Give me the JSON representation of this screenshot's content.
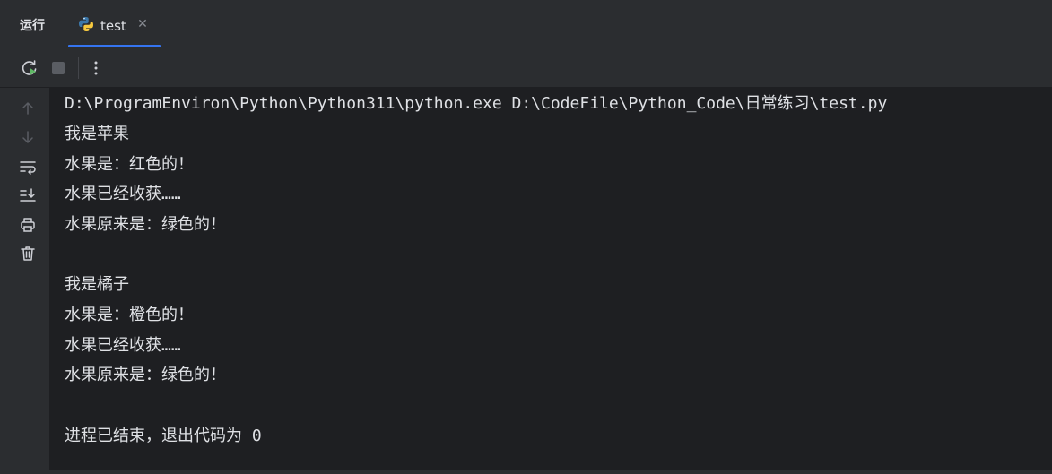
{
  "tool_window": {
    "title": "运行"
  },
  "tabs": [
    {
      "label": "test",
      "icon": "python-icon",
      "close_icon": "close-icon",
      "close_glyph": "✕",
      "active": true
    }
  ],
  "toolbar": {
    "buttons": [
      {
        "name": "rerun-button",
        "icon": "rerun-icon"
      },
      {
        "name": "stop-button",
        "icon": "stop-icon"
      },
      {
        "name": "more-options-button",
        "icon": "more-vertical-icon"
      }
    ]
  },
  "gutter": {
    "buttons": [
      {
        "name": "scroll-up-button",
        "icon": "arrow-up-icon"
      },
      {
        "name": "scroll-down-button",
        "icon": "arrow-down-icon"
      },
      {
        "name": "soft-wrap-button",
        "icon": "soft-wrap-icon"
      },
      {
        "name": "scroll-to-end-button",
        "icon": "scroll-to-end-icon"
      },
      {
        "name": "print-button",
        "icon": "printer-icon"
      },
      {
        "name": "clear-all-button",
        "icon": "trash-icon"
      }
    ]
  },
  "console": {
    "lines": [
      "D:\\ProgramEnviron\\Python\\Python311\\python.exe D:\\CodeFile\\Python_Code\\日常练习\\test.py",
      "我是苹果",
      "水果是：红色的！",
      "水果已经收获……",
      "水果原来是：绿色的！",
      "",
      "我是橘子",
      "水果是：橙色的！",
      "水果已经收获……",
      "水果原来是：绿色的！",
      "",
      "进程已结束，退出代码为 0"
    ]
  },
  "colors": {
    "background": "#2b2d30",
    "console_background": "#1e1f22",
    "text": "#dfe1e5",
    "accent": "#3574f0",
    "icon": "#ced0d6",
    "icon_disabled": "#5a5d63",
    "run_green": "#5fb865"
  }
}
